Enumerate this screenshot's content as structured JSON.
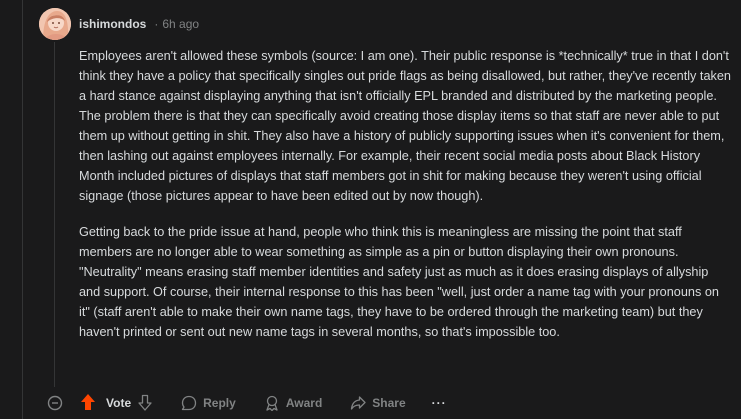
{
  "comment": {
    "author": "ishimondos",
    "separator": "·",
    "timestamp": "6h ago",
    "paragraphs": [
      "Employees aren't allowed these symbols (source: I am one). Their public response is *technically* true in that I don't think they have a policy that specifically singles out pride flags as being disallowed, but rather, they've recently taken a hard stance against displaying anything that isn't officially EPL branded and distributed by the marketing people. The problem there is that they can specifically avoid creating those display items so that staff are never able to put them up without getting in shit. They also have a history of publicly supporting issues when it's convenient for them, then lashing out against employees internally. For example, their recent social media posts about Black History Month included pictures of displays that staff members got in shit for making because they weren't using official signage (those pictures appear to have been edited out by now though).",
      "Getting back to the pride issue at hand, people who think this is meaningless are missing the point that staff members are no longer able to wear something as simple as a pin or button displaying their own pronouns. \"Neutrality\" means erasing staff member identities and safety just as much as it does erasing displays of allyship and support. Of course, their internal response to this has been \"well, just order a name tag with your pronouns on it\" (staff aren't able to make their own name tags, they have to be ordered through the marketing team) but they haven't printed or sent out new name tags in several months, so that's impossible too."
    ]
  },
  "actions": {
    "vote_label": "Vote",
    "reply_label": "Reply",
    "award_label": "Award",
    "share_label": "Share",
    "more_label": "···"
  },
  "colors": {
    "background": "#1a1a1b",
    "text": "#d7dadc",
    "muted": "#818384",
    "upvote_active": "#ff4500"
  },
  "icons": [
    "collapse-icon",
    "upvote-icon",
    "downvote-icon",
    "reply-icon",
    "award-icon",
    "share-icon",
    "more-icon"
  ]
}
